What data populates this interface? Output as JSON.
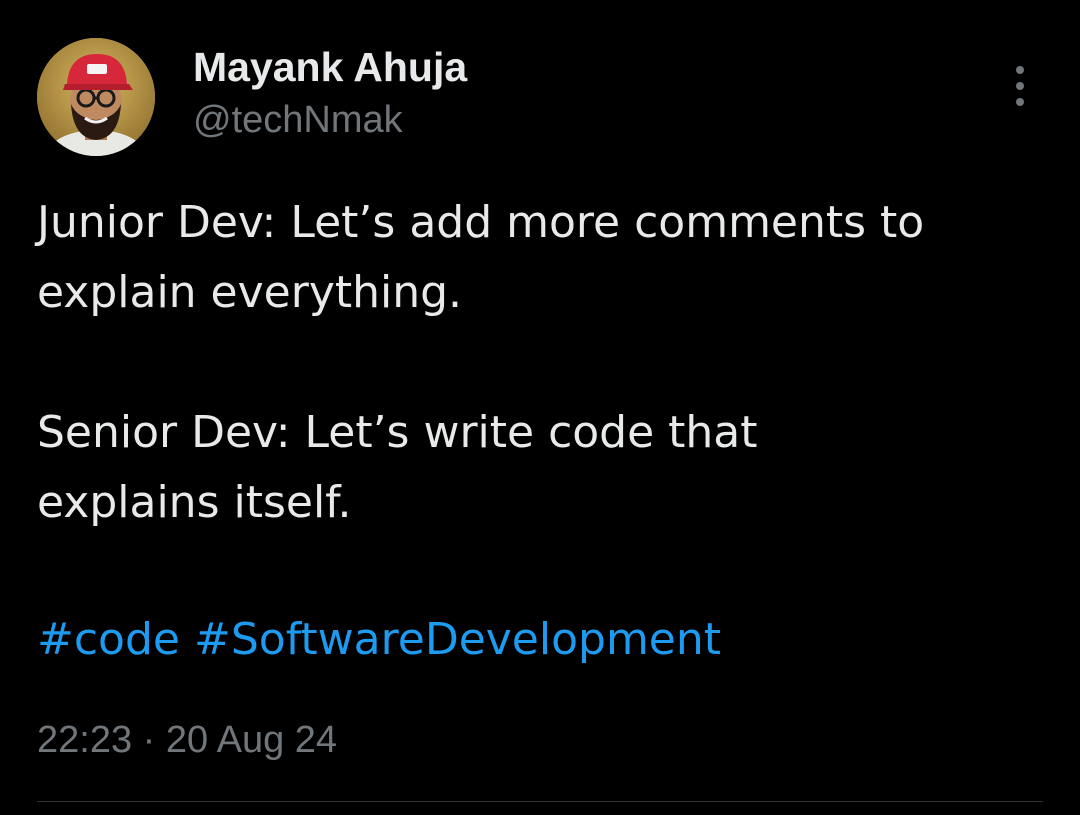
{
  "author": {
    "name": "Mayank Ahuja",
    "handle": "@techNmak"
  },
  "tweet": {
    "paragraphs": [
      "Junior Dev: Let’s add more comments to\nexplain everything.",
      "Senior Dev: Let’s write code that\nexplains itself."
    ],
    "hashtags": [
      "#code",
      "#SoftwareDevelopment"
    ],
    "time": "22:23",
    "separator": "·",
    "date": "20 Aug 24"
  },
  "icons": {
    "more": "vertical-ellipsis-icon"
  },
  "colors": {
    "background": "#000000",
    "primary_text": "#e7e9ea",
    "secondary_text": "#71767b",
    "link": "#1d9bf0",
    "divider": "#2f3336"
  }
}
